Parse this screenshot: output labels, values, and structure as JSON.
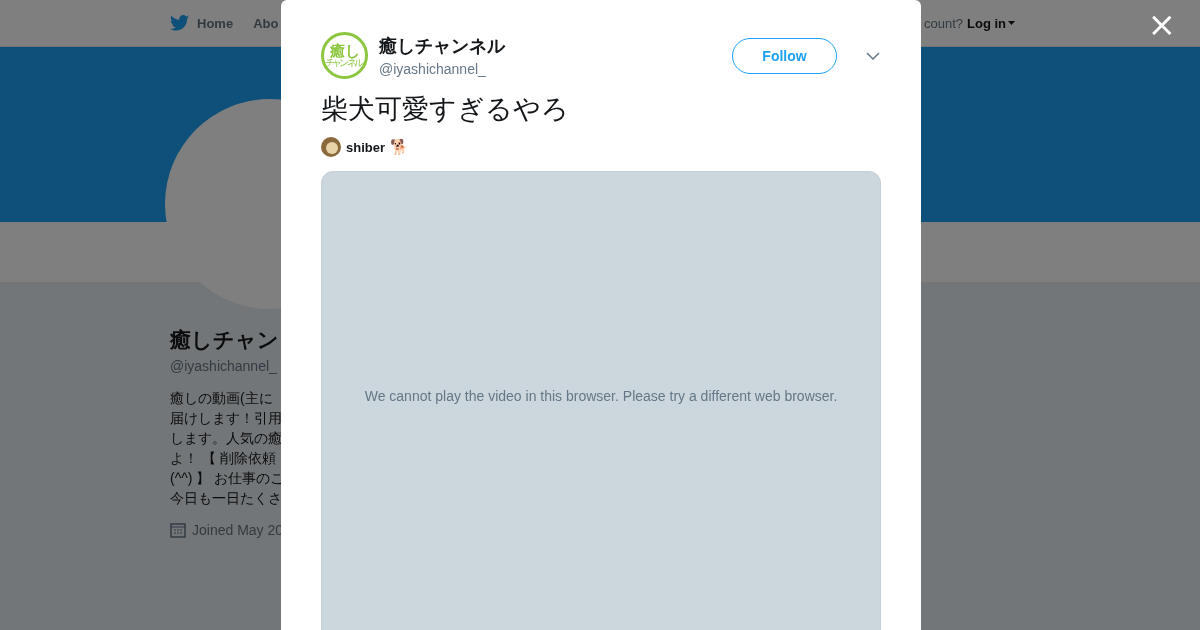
{
  "background_page": {
    "nav": {
      "home": "Home",
      "about": "Abo",
      "account_prompt": "count?",
      "login": "Log in"
    },
    "profile": {
      "name": "癒しチャン",
      "handle": "@iyashichannel_",
      "bio_lines": [
        "癒しの動画(主に",
        "届けします！引用",
        "します。人気の癒",
        "よ！ 【 削除依頼",
        "(^^) 】 お仕事のこ",
        "今日も一日たくさ"
      ],
      "joined": "Joined May 20"
    }
  },
  "close_button": "×",
  "tweet": {
    "author": {
      "name": "癒しチャンネル",
      "handle": "@iyashichannel_",
      "avatar_text": "癒し",
      "avatar_subtext": "チャンネル"
    },
    "follow_button": "Follow",
    "text": "柴犬可愛すぎるやろ",
    "credit": {
      "name": "shiber",
      "emoji": "🐕"
    },
    "video_message": "We cannot play the video in this browser. Please try a different web browser."
  }
}
